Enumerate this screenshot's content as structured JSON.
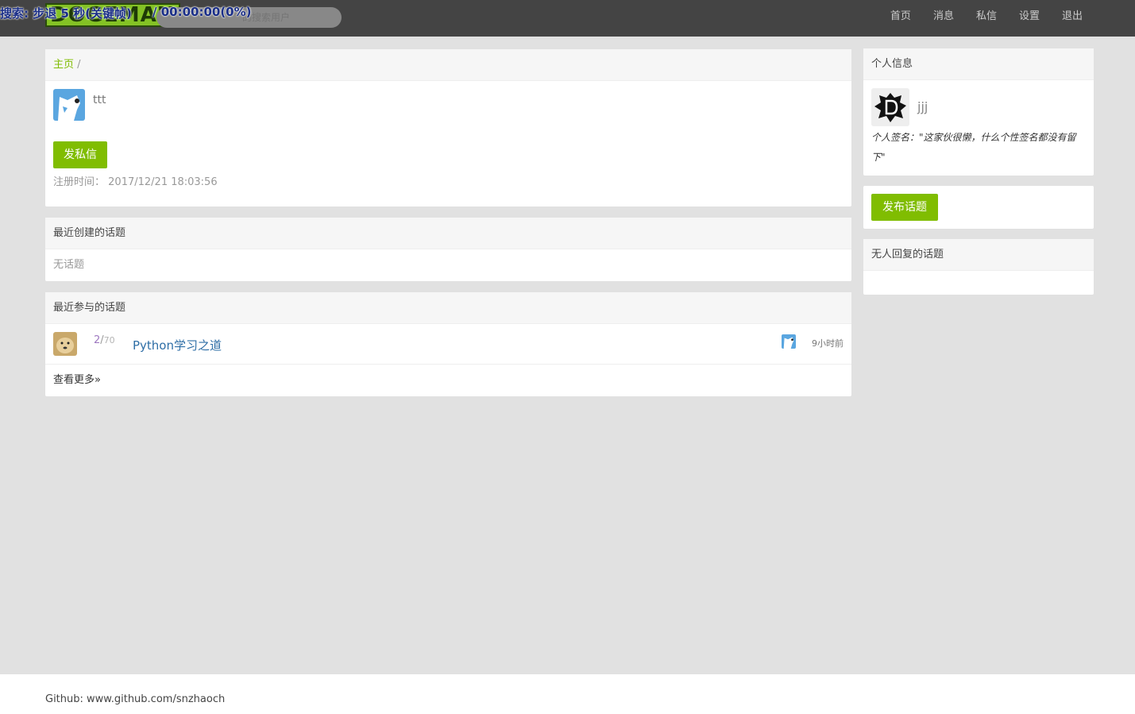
{
  "overlay": {
    "search_label": "搜索:",
    "step_text": "步退 5 秒(关键帧)",
    "time_text": "/ 00:00:00(0%)"
  },
  "navbar": {
    "brand": "DOGEMAN",
    "search_placeholder": "的搜索用户",
    "links": [
      "首页",
      "消息",
      "私信",
      "设置",
      "退出"
    ]
  },
  "profile": {
    "breadcrumb_home": "主页",
    "breadcrumb_sep": "/",
    "username": "ttt",
    "send_message_label": "发私信",
    "register_label": "注册时间：",
    "register_time": "2017/12/21 18:03:56"
  },
  "recent_created": {
    "title": "最近创建的话题",
    "empty_text": "无话题"
  },
  "recent_joined": {
    "title": "最近参与的话题",
    "topics": [
      {
        "reply_count": "2",
        "view_count": "70",
        "title": "Python学习之道",
        "time_ago": "9小时前"
      }
    ],
    "more_link": "查看更多»"
  },
  "sidebar": {
    "info_title": "个人信息",
    "username": "jjj",
    "signature": "个人签名：\"这家伙很懒，什么个性签名都没有留下\"",
    "post_topic_label": "发布话题",
    "noreply_title": "无人回复的话题"
  },
  "footer": {
    "text": "Github: www.github.com/snzhaoch"
  },
  "colors": {
    "accent": "#80bd01",
    "navbar": "#444444",
    "page_bg": "#e1e1e1",
    "link": "#2e6ea6"
  }
}
